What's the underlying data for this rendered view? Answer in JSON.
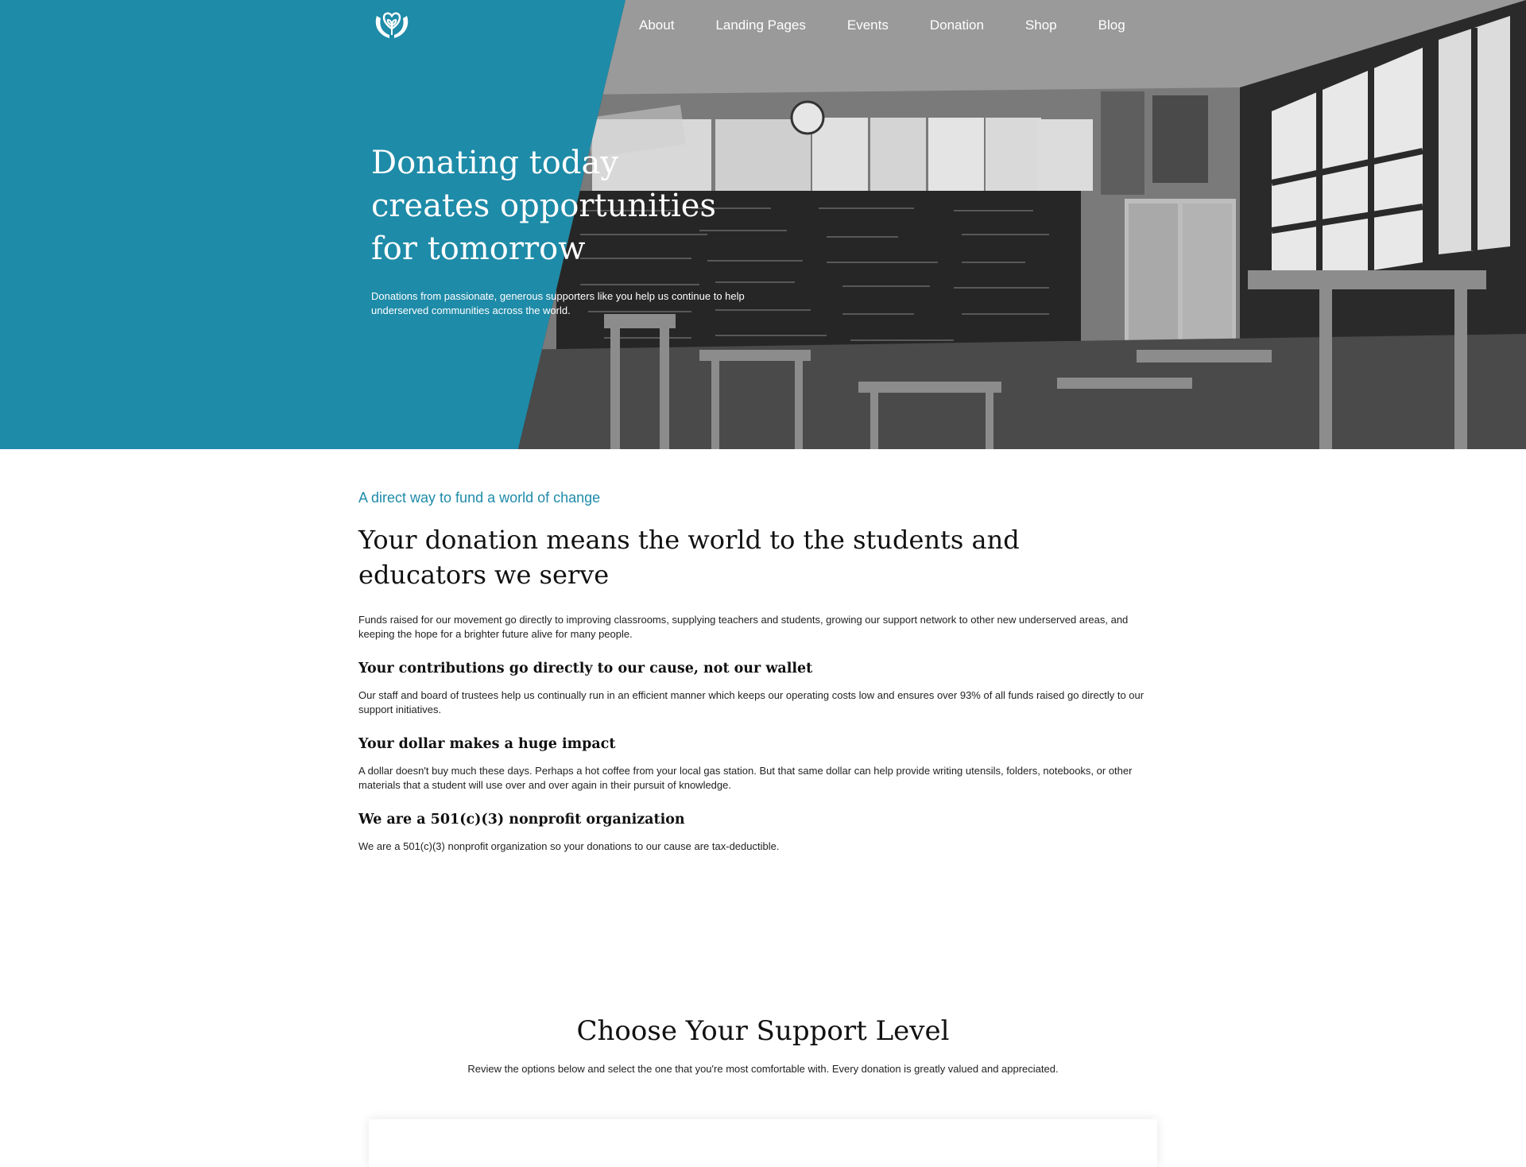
{
  "colors": {
    "brand": "#1e8ba8",
    "text": "#111111",
    "body_text": "#222222"
  },
  "nav": {
    "logo_icon": "heart-hands-plant-icon",
    "links": [
      "About",
      "Landing Pages",
      "Events",
      "Donation",
      "Shop",
      "Blog"
    ]
  },
  "hero": {
    "title": "Donating today creates opportunities for tomorrow",
    "subtitle": "Donations from passionate, generous supporters like you help us continue to help underserved communities across the world.",
    "image_description": "black and white classroom photo"
  },
  "intro": {
    "eyebrow": "A direct way to fund a world of change",
    "title": "Your donation means the world to the students and educators we serve",
    "paragraph": "Funds raised for our movement go directly to improving classrooms, supplying teachers and students, growing our support network to other new underserved areas, and keeping the hope for a brighter future alive for many people."
  },
  "sections": [
    {
      "heading": "Your contributions go directly to our cause, not our wallet",
      "text": "Our staff and board of trustees help us continually run in an efficient manner which keeps our operating costs low and ensures over 93% of all funds raised go directly to our support initiatives."
    },
    {
      "heading": "Your dollar makes a huge impact",
      "text": "A dollar doesn't buy much these days. Perhaps a hot coffee from your local gas station. But that same dollar can help provide writing utensils, folders, notebooks, or other materials that a student will use over and over again in their pursuit of knowledge."
    },
    {
      "heading": "We are a 501(c)(3) nonprofit organization",
      "text": "We are a 501(c)(3) nonprofit organization so your donations to our cause are tax-deductible."
    }
  ],
  "support": {
    "title": "Choose Your Support Level",
    "subtitle": "Review the options below and select the one that you're most comfortable with. Every donation is greatly valued and appreciated."
  }
}
